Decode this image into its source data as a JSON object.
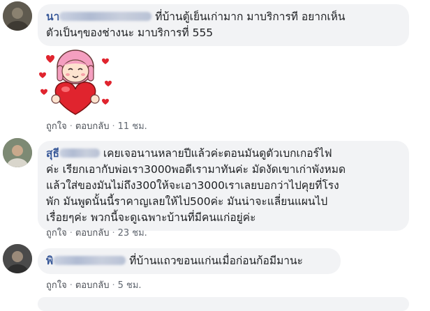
{
  "comments": [
    {
      "name_visible": "นา",
      "text_lines": [
        "ที่บ้านตู้เย็นเก่ามาก มาบริการที อยากเห็น",
        "ตัวเป็นๆของช่างนะ มาบริการที่ 555"
      ],
      "like_label": "ถูกใจ",
      "reply_label": "ตอบกลับ",
      "time": "11 ชม.",
      "sticker_icon": "girl-holding-heart-sticker"
    },
    {
      "name_visible": "สุธี",
      "text_lines": [
        "เคยเจอนานหลายปีแล้วค่ะตอนมันดูตัวเบกเกอร์ไฟ",
        "ค่ะ เรียกเอากับพ่อเรา3000พอดีเรามาทันค่ะ มัดงัดเขาเก่าพังหมด",
        "แล้วใส่ของมันไม่ถึง300ให้จะเอา3000เราเลยบอกว่าไปคุยที่โรง",
        "พัก มันพูดนั้นนี้ราคาญเลยให้ไป500ค่ะ มันน่าจะแลี่ยนแผนไป",
        "เรื่อยๆค่ะ พวกนี้จะดูเฉพาะบ้านที่มีคนแก่อยู่ค่ะ"
      ],
      "like_label": "ถูกใจ",
      "reply_label": "ตอบกลับ",
      "time": "23 ชม."
    },
    {
      "name_visible": "พิ",
      "text_lines": [
        "ที่บ้านแถวขอนแก่นเมื่อก่อนก้อมีมานะ"
      ],
      "like_label": "ถูกใจ",
      "reply_label": "ตอบกลับ",
      "time": "5 ชม."
    }
  ],
  "colors": {
    "bubble": "#f2f3f5",
    "name": "#385898",
    "meta": "#606770",
    "heart": "#e0242e",
    "hair": "#f49fc0"
  }
}
